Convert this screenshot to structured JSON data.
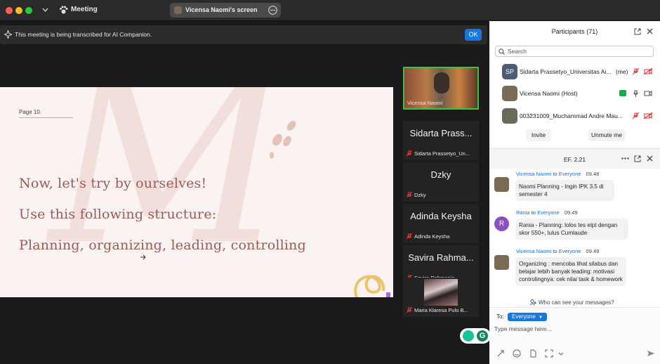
{
  "window": {
    "title": "Meeting",
    "screen_share_label": "Vicensa Naomi's screen"
  },
  "banner": {
    "text": "This meeting is being transcribed for AI Companion.",
    "ok_label": "OK"
  },
  "slide": {
    "page_label": "Page 10.",
    "line1": "Now, let's try by ourselves!",
    "line2": "Use this following structure:",
    "line3": "Planning, organizing, leading, controlling",
    "colors": {
      "background": "#fbf3f2",
      "text": "#9a5a55",
      "accent": "#e3c3b5"
    }
  },
  "tiles": [
    {
      "name": "",
      "label": "Vicensa Naomi",
      "video": true,
      "active": true
    },
    {
      "name": "Sidarta Prass...",
      "label": "Sidarta Prassetyo_Un...",
      "video": false
    },
    {
      "name": "Dzky",
      "label": "Dzky",
      "video": false
    },
    {
      "name": "Adinda Keysha",
      "label": "Adinda Keysha",
      "video": false
    },
    {
      "name": "Savira Rahma...",
      "label": "Savira Rahmania",
      "video": false
    },
    {
      "name": "",
      "label": "Maria Klaresa Pulo B...",
      "video": true
    }
  ],
  "participants": {
    "title": "Participants (71)",
    "search_placeholder": "Search",
    "list": [
      {
        "initials": "SP",
        "name": "Sidarta Prassetyo_Universitas Ai...",
        "suffix": "(me)"
      },
      {
        "initials": "",
        "name": "Vicensa Naomi (Host)",
        "suffix": ""
      },
      {
        "initials": "",
        "name": "003231009_Muchammad Andre Mau...",
        "suffix": ""
      }
    ],
    "invite_label": "Invite",
    "unmute_label": "Unmute me"
  },
  "chat": {
    "title": "EF. 2.21",
    "messages": [
      {
        "from": "Vicensa Naomi",
        "to": "Everyone",
        "time": "09.48",
        "text": "Naomi Planning - Ingin IPK 3.5 di semester 4",
        "avatar": ""
      },
      {
        "from": "Rania",
        "to": "Everyone",
        "time": "09.49",
        "text": "Rania - Planning: lolos tes elpt dengan skor 550+, lulus Cumlaude",
        "avatar": "R"
      },
      {
        "from": "Vicensa Naomi",
        "to": "Everyone",
        "time": "09.49",
        "text": "Organizing : mencoba lihat silabus dan belajar lebih banyak leading: motivasi controlingnya: cek nilai task & homework",
        "avatar": ""
      }
    ],
    "to_word": "to",
    "visibility": "Who can see your messages?",
    "to_label": "To:",
    "to_value": "Everyone",
    "input_placeholder": "Type message here..."
  }
}
